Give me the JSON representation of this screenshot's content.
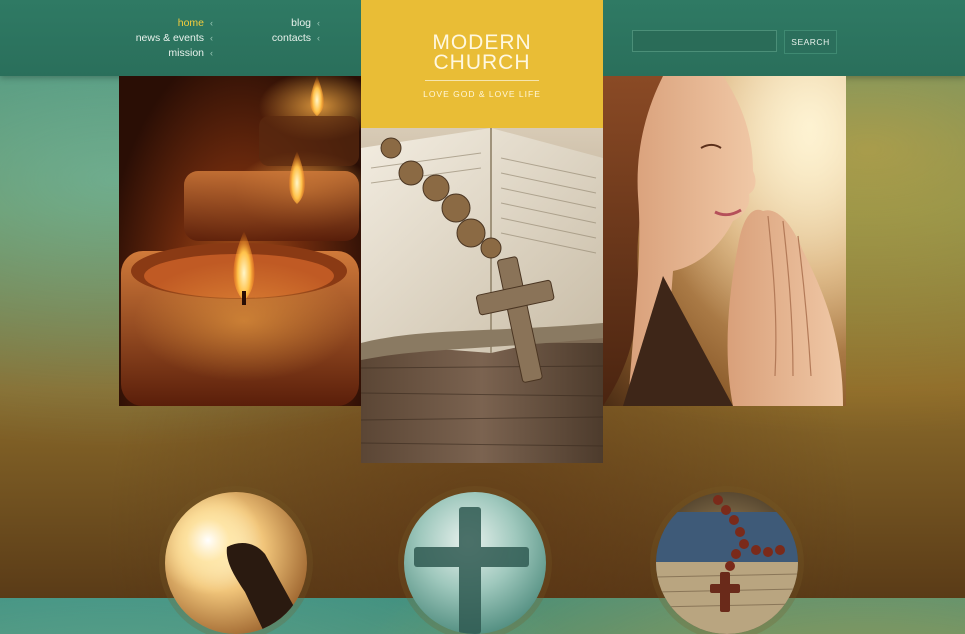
{
  "nav": {
    "left": [
      {
        "label": "home",
        "active": true
      },
      {
        "label": "news & events",
        "active": false
      },
      {
        "label": "mission",
        "active": false
      }
    ],
    "right": [
      {
        "label": "blog",
        "active": false
      },
      {
        "label": "contacts",
        "active": false
      }
    ],
    "chevron": "‹"
  },
  "logo": {
    "line1": "MODERN",
    "line2": "CHURCH",
    "tagline": "LOVE GOD & LOVE LIFE"
  },
  "search": {
    "placeholder": "",
    "button_label": "SEARCH"
  },
  "colors": {
    "topbar": "#2a6f5b",
    "logo_bg": "#e9bd36",
    "active_nav": "#f4cd3c"
  },
  "icons": {
    "nav_chevron": "chevron-left-icon"
  }
}
